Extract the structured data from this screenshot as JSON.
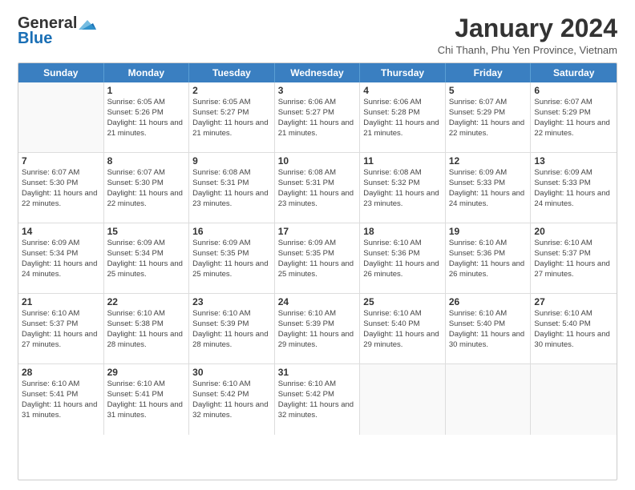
{
  "header": {
    "logo_general": "General",
    "logo_blue": "Blue",
    "month_title": "January 2024",
    "location": "Chi Thanh, Phu Yen Province, Vietnam"
  },
  "weekdays": [
    "Sunday",
    "Monday",
    "Tuesday",
    "Wednesday",
    "Thursday",
    "Friday",
    "Saturday"
  ],
  "weeks": [
    [
      {
        "day": "",
        "sunrise": "",
        "sunset": "",
        "daylight": ""
      },
      {
        "day": "1",
        "sunrise": "6:05 AM",
        "sunset": "5:26 PM",
        "daylight": "11 hours and 21 minutes."
      },
      {
        "day": "2",
        "sunrise": "6:05 AM",
        "sunset": "5:27 PM",
        "daylight": "11 hours and 21 minutes."
      },
      {
        "day": "3",
        "sunrise": "6:06 AM",
        "sunset": "5:27 PM",
        "daylight": "11 hours and 21 minutes."
      },
      {
        "day": "4",
        "sunrise": "6:06 AM",
        "sunset": "5:28 PM",
        "daylight": "11 hours and 21 minutes."
      },
      {
        "day": "5",
        "sunrise": "6:07 AM",
        "sunset": "5:29 PM",
        "daylight": "11 hours and 22 minutes."
      },
      {
        "day": "6",
        "sunrise": "6:07 AM",
        "sunset": "5:29 PM",
        "daylight": "11 hours and 22 minutes."
      }
    ],
    [
      {
        "day": "7",
        "sunrise": "6:07 AM",
        "sunset": "5:30 PM",
        "daylight": "11 hours and 22 minutes."
      },
      {
        "day": "8",
        "sunrise": "6:07 AM",
        "sunset": "5:30 PM",
        "daylight": "11 hours and 22 minutes."
      },
      {
        "day": "9",
        "sunrise": "6:08 AM",
        "sunset": "5:31 PM",
        "daylight": "11 hours and 23 minutes."
      },
      {
        "day": "10",
        "sunrise": "6:08 AM",
        "sunset": "5:31 PM",
        "daylight": "11 hours and 23 minutes."
      },
      {
        "day": "11",
        "sunrise": "6:08 AM",
        "sunset": "5:32 PM",
        "daylight": "11 hours and 23 minutes."
      },
      {
        "day": "12",
        "sunrise": "6:09 AM",
        "sunset": "5:33 PM",
        "daylight": "11 hours and 24 minutes."
      },
      {
        "day": "13",
        "sunrise": "6:09 AM",
        "sunset": "5:33 PM",
        "daylight": "11 hours and 24 minutes."
      }
    ],
    [
      {
        "day": "14",
        "sunrise": "6:09 AM",
        "sunset": "5:34 PM",
        "daylight": "11 hours and 24 minutes."
      },
      {
        "day": "15",
        "sunrise": "6:09 AM",
        "sunset": "5:34 PM",
        "daylight": "11 hours and 25 minutes."
      },
      {
        "day": "16",
        "sunrise": "6:09 AM",
        "sunset": "5:35 PM",
        "daylight": "11 hours and 25 minutes."
      },
      {
        "day": "17",
        "sunrise": "6:09 AM",
        "sunset": "5:35 PM",
        "daylight": "11 hours and 25 minutes."
      },
      {
        "day": "18",
        "sunrise": "6:10 AM",
        "sunset": "5:36 PM",
        "daylight": "11 hours and 26 minutes."
      },
      {
        "day": "19",
        "sunrise": "6:10 AM",
        "sunset": "5:36 PM",
        "daylight": "11 hours and 26 minutes."
      },
      {
        "day": "20",
        "sunrise": "6:10 AM",
        "sunset": "5:37 PM",
        "daylight": "11 hours and 27 minutes."
      }
    ],
    [
      {
        "day": "21",
        "sunrise": "6:10 AM",
        "sunset": "5:37 PM",
        "daylight": "11 hours and 27 minutes."
      },
      {
        "day": "22",
        "sunrise": "6:10 AM",
        "sunset": "5:38 PM",
        "daylight": "11 hours and 28 minutes."
      },
      {
        "day": "23",
        "sunrise": "6:10 AM",
        "sunset": "5:39 PM",
        "daylight": "11 hours and 28 minutes."
      },
      {
        "day": "24",
        "sunrise": "6:10 AM",
        "sunset": "5:39 PM",
        "daylight": "11 hours and 29 minutes."
      },
      {
        "day": "25",
        "sunrise": "6:10 AM",
        "sunset": "5:40 PM",
        "daylight": "11 hours and 29 minutes."
      },
      {
        "day": "26",
        "sunrise": "6:10 AM",
        "sunset": "5:40 PM",
        "daylight": "11 hours and 30 minutes."
      },
      {
        "day": "27",
        "sunrise": "6:10 AM",
        "sunset": "5:40 PM",
        "daylight": "11 hours and 30 minutes."
      }
    ],
    [
      {
        "day": "28",
        "sunrise": "6:10 AM",
        "sunset": "5:41 PM",
        "daylight": "11 hours and 31 minutes."
      },
      {
        "day": "29",
        "sunrise": "6:10 AM",
        "sunset": "5:41 PM",
        "daylight": "11 hours and 31 minutes."
      },
      {
        "day": "30",
        "sunrise": "6:10 AM",
        "sunset": "5:42 PM",
        "daylight": "11 hours and 32 minutes."
      },
      {
        "day": "31",
        "sunrise": "6:10 AM",
        "sunset": "5:42 PM",
        "daylight": "11 hours and 32 minutes."
      },
      {
        "day": "",
        "sunrise": "",
        "sunset": "",
        "daylight": ""
      },
      {
        "day": "",
        "sunrise": "",
        "sunset": "",
        "daylight": ""
      },
      {
        "day": "",
        "sunrise": "",
        "sunset": "",
        "daylight": ""
      }
    ]
  ],
  "labels": {
    "sunrise_prefix": "Sunrise: ",
    "sunset_prefix": "Sunset: ",
    "daylight_prefix": "Daylight: "
  }
}
